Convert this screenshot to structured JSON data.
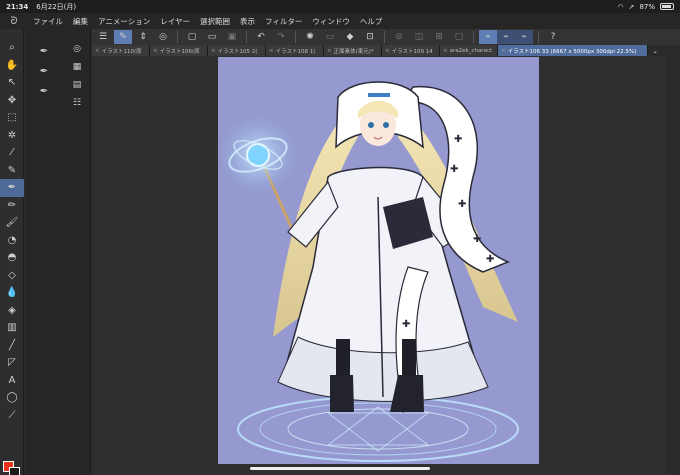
{
  "status": {
    "time": "21:34",
    "date": "6月22日(月)",
    "battery": "87%"
  },
  "menubar": {
    "items": [
      "ファイル",
      "編集",
      "アニメーション",
      "レイヤー",
      "選択範囲",
      "表示",
      "フィルター",
      "ウィンドウ",
      "ヘルプ"
    ]
  },
  "tabs": [
    {
      "label": "イラスト110(原"
    },
    {
      "label": "イラスト106(原"
    },
    {
      "label": "イラスト105 2("
    },
    {
      "label": "イラスト108 1("
    },
    {
      "label": "正面素体(東元)*"
    },
    {
      "label": "イラスト109 14"
    },
    {
      "label": "ara2ek_charact"
    },
    {
      "label": "イラスト106 33 (6667 x 5000px 300dpi 22.5%)"
    }
  ],
  "colors": {
    "main": "#e8321a",
    "sub": "#1a1a1a",
    "canvas_bg": "#9599cf",
    "accent": "#506c9c"
  }
}
